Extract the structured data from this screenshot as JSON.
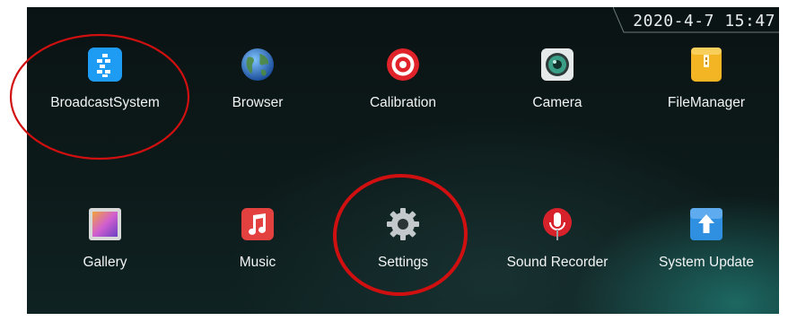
{
  "status": {
    "datetime": "2020-4-7 15:47"
  },
  "apps": [
    {
      "label": "BroadcastSystem",
      "icon": "broadcast-system-icon",
      "color": "#2aa3f5"
    },
    {
      "label": "Browser",
      "icon": "globe-icon",
      "color": "#3a7bd5"
    },
    {
      "label": "Calibration",
      "icon": "target-icon",
      "color": "#e02525"
    },
    {
      "label": "Camera",
      "icon": "camera-icon",
      "color": "#eaeaea"
    },
    {
      "label": "FileManager",
      "icon": "file-manager-icon",
      "color": "#f0b323"
    },
    {
      "label": "Gallery",
      "icon": "gallery-icon",
      "color": "#c76fd6"
    },
    {
      "label": "Music",
      "icon": "music-note-icon",
      "color": "#e14040"
    },
    {
      "label": "Settings",
      "icon": "gear-icon",
      "color": "#bfc4c6"
    },
    {
      "label": "Sound Recorder",
      "icon": "microphone-icon",
      "color": "#d8202a"
    },
    {
      "label": "System Update",
      "icon": "upload-arrow-icon",
      "color": "#2b8fe0"
    }
  ],
  "annotation_color": "#d01010"
}
